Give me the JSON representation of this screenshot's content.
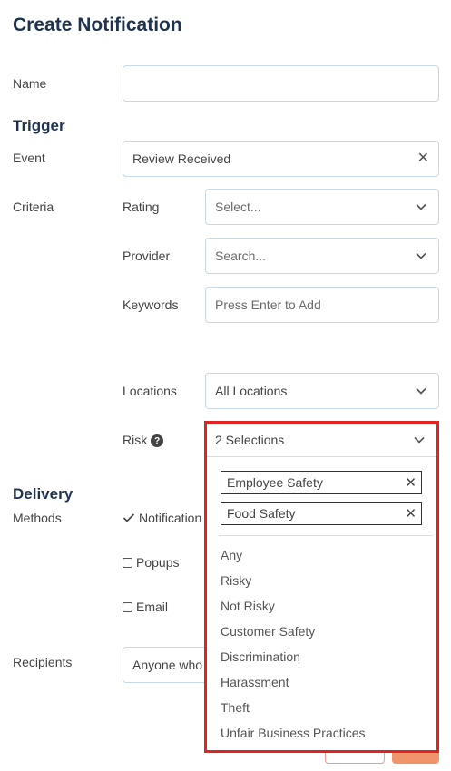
{
  "title": "Create Notification",
  "name": {
    "label": "Name",
    "value": ""
  },
  "trigger": {
    "heading": "Trigger",
    "event": {
      "label": "Event",
      "value": "Review Received"
    },
    "criteria_label": "Criteria",
    "rating": {
      "label": "Rating",
      "placeholder": "Select..."
    },
    "provider": {
      "label": "Provider",
      "placeholder": "Search..."
    },
    "keywords": {
      "label": "Keywords",
      "placeholder": "Press Enter to Add"
    },
    "locations": {
      "label": "Locations",
      "value": "All Locations"
    },
    "risk": {
      "label": "Risk",
      "help": "?",
      "value": "2 Selections",
      "selected": [
        "Employee Safety",
        "Food Safety"
      ],
      "options": [
        "Any",
        "Risky",
        "Not Risky",
        "Customer Safety",
        "Discrimination",
        "Harassment",
        "Theft",
        "Unfair Business Practices"
      ]
    }
  },
  "delivery": {
    "heading": "Delivery",
    "methods_label": "Methods",
    "methods": [
      {
        "label": "Notification",
        "checked": true
      },
      {
        "label": "Popups",
        "checked": false
      },
      {
        "label": "Email",
        "checked": false
      }
    ]
  },
  "recipients": {
    "label": "Recipients",
    "value": "Anyone who"
  },
  "colors": {
    "heading": "#1f3350",
    "border": "#c9d8e6",
    "highlight": "#e02424",
    "accent": "#f0946c"
  }
}
